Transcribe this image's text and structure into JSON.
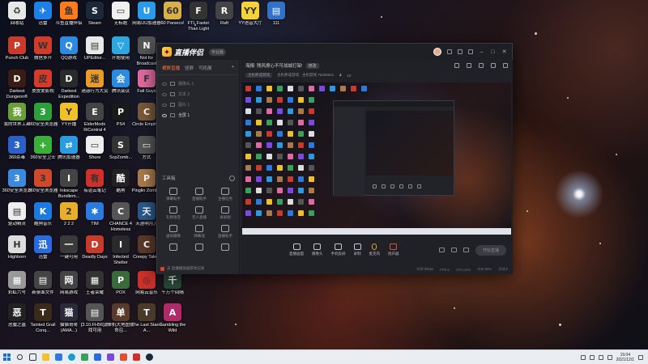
{
  "desktop": {
    "icons": [
      {
        "label": "回收站",
        "color": "#e8e8e8",
        "glyph": "♻"
      },
      {
        "label": "迅雷",
        "color": "#1f7fe8",
        "glyph": "✈"
      },
      {
        "label": "斗鱼直播伴侣",
        "color": "#ff7a1a",
        "glyph": "鱼"
      },
      {
        "label": "Steam",
        "color": "#1b2838",
        "glyph": "S"
      },
      {
        "label": "无标题",
        "color": "#f0f0f0",
        "glyph": "▭"
      },
      {
        "label": "网易UU加速器",
        "color": "#2a9be8",
        "glyph": "U"
      },
      {
        "label": "60 Parsecs!",
        "color": "#d8b04a",
        "glyph": "60"
      },
      {
        "label": "FTL Faster Than Light",
        "color": "#333",
        "glyph": "F"
      },
      {
        "label": "Raft",
        "color": "#444",
        "glyph": "R"
      },
      {
        "label": "YY语音大厅",
        "color": "#f5d23a",
        "glyph": "YY"
      },
      {
        "label": "111",
        "color": "#2f72c8",
        "glyph": "▤"
      },
      {
        "label": "Punch Club",
        "color": "#c83a2a",
        "glyph": "P"
      },
      {
        "label": "微信多开",
        "color": "#d23a2a",
        "glyph": "W"
      },
      {
        "label": "QQ游戏",
        "color": "#2c8be0",
        "glyph": "Q"
      },
      {
        "label": "UPEditor...",
        "color": "#e8e8e8",
        "glyph": "▤"
      },
      {
        "label": "开始使用",
        "color": "#2ca7e0",
        "glyph": "▽"
      },
      {
        "label": "Not for Broadcast",
        "color": "#555",
        "glyph": "N"
      },
      {
        "label": "Darkest Dungeon®",
        "color": "#3a1c14",
        "glyph": "D"
      },
      {
        "label": "皮皮爱影视",
        "color": "#d63a2a",
        "glyph": "皮"
      },
      {
        "label": "Darkest Expedition",
        "color": "#2a2a2a",
        "glyph": "D"
      },
      {
        "label": "迷惑行为大赏",
        "color": "#e89a2a",
        "glyph": "迷"
      },
      {
        "label": "腾讯会议",
        "color": "#2a8be0",
        "glyph": "会"
      },
      {
        "label": "Fall Guys",
        "color": "#e06aa0",
        "glyph": "F"
      },
      {
        "label": "我的世界工具",
        "color": "#6aa03a",
        "glyph": "我"
      },
      {
        "label": "360安全浏览器",
        "color": "#2ca03a",
        "glyph": "3"
      },
      {
        "label": "YY开播",
        "color": "#f0c02a",
        "glyph": "Y"
      },
      {
        "label": "ElderMods RiCentral 4",
        "color": "#444",
        "glyph": "E"
      },
      {
        "label": "PS4",
        "color": "#1a1a1a",
        "glyph": "P"
      },
      {
        "label": "Circle Empires",
        "color": "#7a5a3a",
        "glyph": "C"
      },
      {
        "label": "360杀毒",
        "color": "#2a60c8",
        "glyph": "3"
      },
      {
        "label": "360安全卫士",
        "color": "#3ab03a",
        "glyph": "+"
      },
      {
        "label": "腾讯加速器",
        "color": "#2a9be0",
        "glyph": "⇄"
      },
      {
        "label": "Shure",
        "color": "#eee",
        "glyph": "▭"
      },
      {
        "label": "ScpZomb...",
        "color": "#333",
        "glyph": "S"
      },
      {
        "label": "方式",
        "color": "#555",
        "glyph": "▭"
      },
      {
        "label": "360安全浏览器",
        "color": "#3a8ae0",
        "glyph": "3"
      },
      {
        "label": "360安全浏览器",
        "color": "#d04a2a",
        "glyph": "3"
      },
      {
        "label": "Inkscape Bundlem...",
        "color": "#444",
        "glyph": "I"
      },
      {
        "label": "有道云笔记",
        "color": "#d0302a",
        "glyph": "有"
      },
      {
        "label": "酷狗",
        "color": "#222",
        "glyph": "酷"
      },
      {
        "label": "Pinglin Zombie",
        "color": "#aa7a4a",
        "glyph": "P"
      },
      {
        "label": "驱动精灵",
        "color": "#eee",
        "glyph": "▤"
      },
      {
        "label": "酷狗音乐",
        "color": "#1a7ae0",
        "glyph": "K"
      },
      {
        "label": "2 2 2",
        "color": "#e8b02a",
        "glyph": "2"
      },
      {
        "label": "TIM",
        "color": "#2a7ae0",
        "glyph": "✱"
      },
      {
        "label": "CHANCE 4 Homeless",
        "color": "#555",
        "glyph": "C"
      },
      {
        "label": "天涯明月刀",
        "color": "#2a5a8a",
        "glyph": "天"
      },
      {
        "label": "Highborn",
        "color": "#ddd",
        "glyph": "H"
      },
      {
        "label": "迅雷",
        "color": "#2a6ae0",
        "glyph": "迅"
      },
      {
        "label": "一键可用",
        "color": "#3a3a3a",
        "glyph": "一"
      },
      {
        "label": "Deadly Days",
        "color": "#c83a2a",
        "glyph": "D"
      },
      {
        "label": "Infected Shelter",
        "color": "#2a2a2a",
        "glyph": "I"
      },
      {
        "label": "Creepy Tale 2",
        "color": "#5a3a2a",
        "glyph": "C"
      },
      {
        "label": "彩虹六号",
        "color": "#999",
        "glyph": "▦"
      },
      {
        "label": "新桌面文件",
        "color": "#444",
        "glyph": "▤"
      },
      {
        "label": "网易游戏",
        "color": "#444",
        "glyph": "网"
      },
      {
        "label": "王者荣耀",
        "color": "#333",
        "glyph": "▦"
      },
      {
        "label": "POX",
        "color": "#3a6a3a",
        "glyph": "P"
      },
      {
        "label": "网易云音乐",
        "color": "#d0302a",
        "glyph": "◎"
      },
      {
        "label": "千万个间隔",
        "color": "#2a4a3a",
        "glyph": "千"
      },
      {
        "label": "恶魔之墓",
        "color": "#222",
        "glyph": "恶"
      },
      {
        "label": "Tainted Grail Conq...",
        "color": "#3a2a1a",
        "glyph": "T"
      },
      {
        "label": "猫猫哥哥(AMA...)",
        "color": "#2a2a3a",
        "glyph": "猫"
      },
      {
        "label": "[3.10.FH56]游戏可用",
        "color": "#555",
        "glyph": "▤"
      },
      {
        "label": "单机大地图使命召...",
        "color": "#5a3a2a",
        "glyph": "单"
      },
      {
        "label": "The Last Stand A...",
        "color": "#4a3a2a",
        "glyph": "T"
      },
      {
        "label": "Gambling the Wild",
        "color": "#b02a6a",
        "glyph": "A"
      }
    ]
  },
  "app": {
    "brand": "直播伴侣",
    "version": "专业版",
    "scene_tabs": [
      "横屏直播",
      "竖屏",
      "可拓展"
    ],
    "sources": [
      {
        "name": "摄像头 1",
        "selected": false
      },
      {
        "name": "文本 2",
        "selected": false
      },
      {
        "name": "图片 1",
        "selected": false
      },
      {
        "name": "全屏 1",
        "selected": true
      }
    ],
    "toolbox_title": "工具箱",
    "tools": [
      "弹幕助手",
      "直播助手",
      "主播任务",
      "礼物语音",
      "无人直播",
      "录屏图",
      "虚拟摄像",
      "弹幕墙",
      "直播助手",
      "",
      "",
      ""
    ],
    "left_footer": "去 直播播放器游戏记录",
    "info_title": "海报: 残风撩心不可战城打架!",
    "info_tag": "修改",
    "category": "主机养成游戏",
    "sub_info": "主机养成游戏 · 主机游戏    76405021",
    "viewer_count": "10",
    "controls": [
      "直播画面",
      "摄像头",
      "手机投屏",
      "录制",
      "麦克风",
      "扬声器"
    ],
    "start_button": "开始直播",
    "status": [
      "码率:0kbps",
      "FPS:0",
      "CPU:12%",
      "内存:58%",
      "丢帧:0"
    ]
  },
  "taskbar": {
    "time": "15:04",
    "date": "2021/12/1"
  }
}
